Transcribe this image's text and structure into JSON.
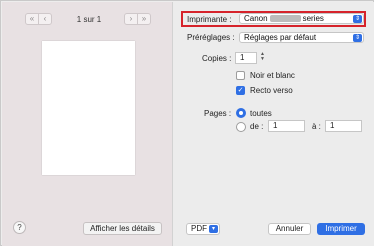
{
  "preview": {
    "prev_icons": [
      "«",
      "‹"
    ],
    "next_icons": [
      "›",
      "»"
    ],
    "page_indicator": "1 sur 1",
    "help_label": "?",
    "details_button": "Afficher les détails"
  },
  "settings": {
    "printer": {
      "label": "Imprimante :",
      "value_prefix": "Canon",
      "value_suffix": "series"
    },
    "presets": {
      "label": "Préréglages :",
      "value": "Réglages par défaut"
    },
    "copies": {
      "label": "Copies :",
      "value": "1"
    },
    "bw": {
      "label": "Noir et blanc",
      "checked": false
    },
    "duplex": {
      "label": "Recto verso",
      "checked": true
    },
    "pages": {
      "label": "Pages :",
      "all_label": "toutes",
      "from_label": "de :",
      "from_value": "1",
      "to_label": "à :",
      "to_value": "1",
      "selected": "all"
    }
  },
  "footer": {
    "pdf_label": "PDF",
    "cancel_label": "Annuler",
    "print_label": "Imprimer"
  },
  "colors": {
    "accent": "#2f6fe4",
    "highlight_border": "#d6232b"
  }
}
